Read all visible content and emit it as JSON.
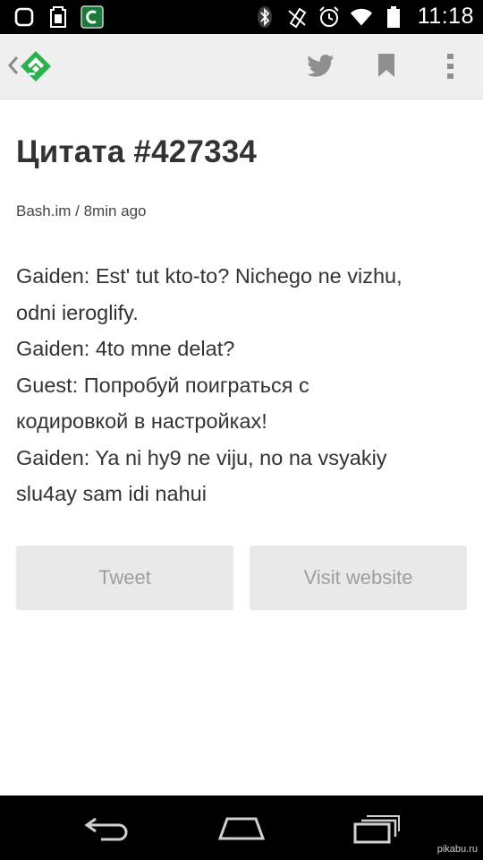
{
  "status_bar": {
    "time": "11:18",
    "left_icons": [
      "square-notification-icon",
      "sim-card-icon",
      "app-c-icon"
    ],
    "right_icons": [
      "bluetooth-icon",
      "mute-icon",
      "alarm-icon",
      "wifi-icon",
      "battery-icon"
    ]
  },
  "app_bar": {
    "back_icon": "chevron-left-icon",
    "logo_icon": "feedly-logo-icon",
    "accent": "#2bb24c",
    "actions": [
      "twitter-icon",
      "bookmark-icon",
      "more-vert-icon"
    ]
  },
  "article": {
    "title": "Цитата #427334",
    "meta": "Bash.im / 8min ago",
    "lines": [
      "Gaiden: Est' tut kto-to? Nichego ne vizhu,",
      "odni ieroglify.",
      "Gaiden: 4to mne delat?",
      "Guest: Попробуй поиграться с",
      "кодировкой в настройках!",
      "Gaiden: Ya ni hy9 ne viju, no na vsyakiy",
      "slu4ay sam idi nahui"
    ]
  },
  "buttons": {
    "tweet": "Tweet",
    "visit": "Visit website"
  },
  "nav_bar": {
    "icons": [
      "back-icon",
      "home-icon",
      "recent-apps-icon"
    ]
  },
  "watermark": "pikabu.ru"
}
